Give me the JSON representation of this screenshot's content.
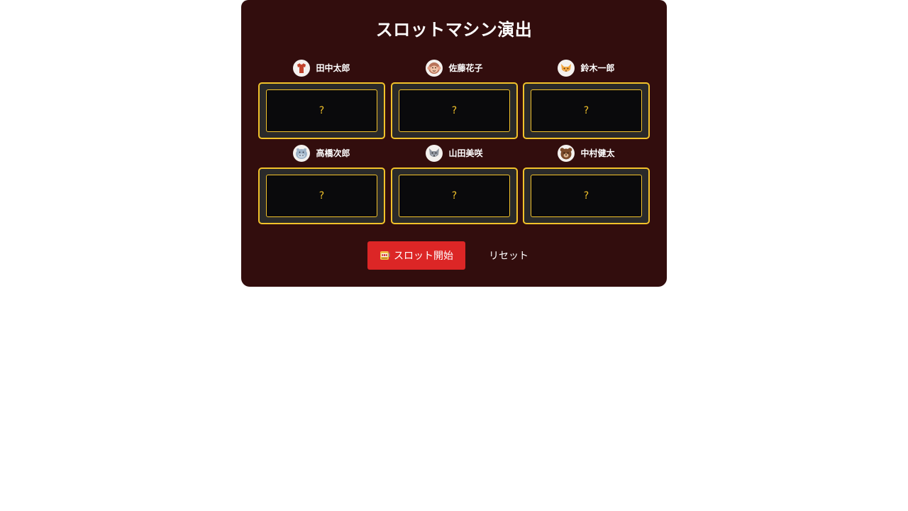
{
  "title": "スロットマシン演出",
  "players": [
    {
      "name": "田中太郎",
      "avatar": "shirt-icon",
      "reel": "?"
    },
    {
      "name": "佐藤花子",
      "avatar": "monkey-face-icon",
      "reel": "?"
    },
    {
      "name": "鈴木一郎",
      "avatar": "fox-face-icon",
      "reel": "?"
    },
    {
      "name": "高橋次郎",
      "avatar": "hippo-face-icon",
      "reel": "?"
    },
    {
      "name": "山田美咲",
      "avatar": "wolf-face-icon",
      "reel": "?"
    },
    {
      "name": "中村健太",
      "avatar": "bear-face-icon",
      "reel": "?"
    }
  ],
  "controls": {
    "start_icon": "slot-machine-icon",
    "start_label": "スロット開始",
    "reset_label": "リセット"
  },
  "colors": {
    "panel_bg": "#320d0d",
    "reel_border": "#f2c22a",
    "start_button": "#dc2626"
  }
}
